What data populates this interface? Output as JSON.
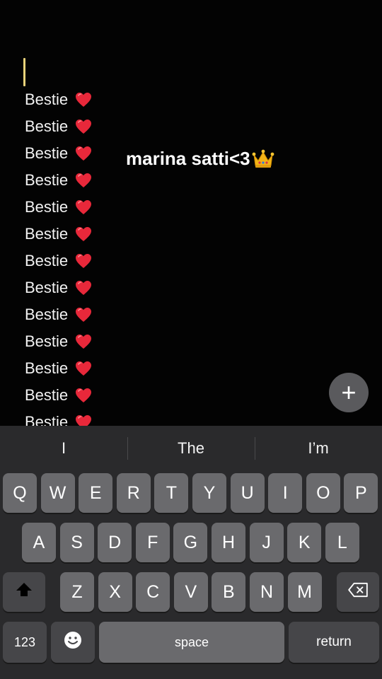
{
  "editor": {
    "lines": [
      "Bestie",
      "Bestie",
      "Bestie",
      "Bestie",
      "Bestie",
      "Bestie",
      "Bestie",
      "Bestie",
      "Bestie",
      "Bestie",
      "Bestie",
      "Bestie",
      "Bestie"
    ],
    "line_emoji": "red-heart-icon"
  },
  "overlay": {
    "text": "marina satti<3",
    "emoji": "crown-icon"
  },
  "fab": {
    "label": "+"
  },
  "keyboard": {
    "suggestions": [
      "I",
      "The",
      "I’m"
    ],
    "row1": [
      "Q",
      "W",
      "E",
      "R",
      "T",
      "Y",
      "U",
      "I",
      "O",
      "P"
    ],
    "row2": [
      "A",
      "S",
      "D",
      "F",
      "G",
      "H",
      "J",
      "K",
      "L"
    ],
    "row3": [
      "Z",
      "X",
      "C",
      "V",
      "B",
      "N",
      "M"
    ],
    "numbers_label": "123",
    "space_label": "space",
    "return_label": "return"
  }
}
